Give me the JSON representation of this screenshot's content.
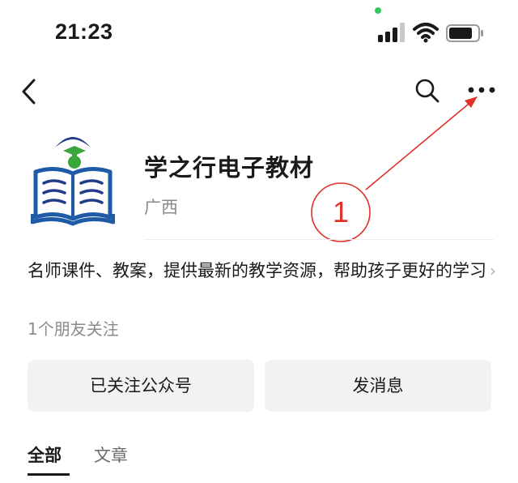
{
  "status_bar": {
    "time": "21:23"
  },
  "nav": {
    "back_icon": "chevron-left-icon",
    "search_icon": "search-icon",
    "more_icon": "more-horizontal-icon"
  },
  "annotation": {
    "number": "1",
    "color": "#e03127"
  },
  "profile": {
    "name": "学之行电子教材",
    "region": "广西",
    "description": "名师课件、教案，提供最新的教学资源，帮助孩子更好的学习",
    "description_more_icon": "›",
    "friends_following": "1个朋友关注"
  },
  "actions": {
    "follow_label": "已关注公众号",
    "message_label": "发消息"
  },
  "tabs": [
    {
      "label": "全部",
      "active": true
    },
    {
      "label": "文章",
      "active": false
    }
  ],
  "colors": {
    "logo_blue": "#1f5aa6",
    "logo_green": "#3aa53a",
    "logo_navy": "#243a8a",
    "button_bg": "#f2f2f2"
  }
}
